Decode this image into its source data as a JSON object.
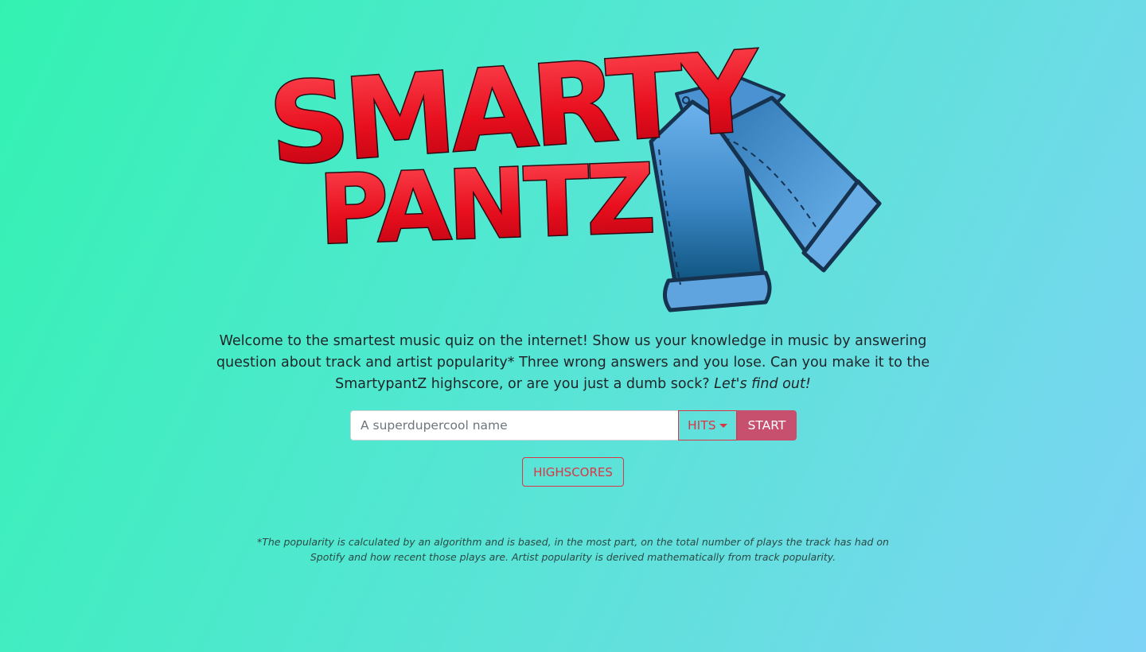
{
  "logo": {
    "line1": "SMARTY",
    "line2": "PANTZ",
    "icon": "jeans-icon",
    "colors": {
      "letters": "#e8101e",
      "outline": "#16324f",
      "jeans_light": "#5aa6e6",
      "jeans_dark": "#0d5a86"
    }
  },
  "intro": {
    "text": "Welcome to the smartest music quiz on the internet! Show us your knowledge in music by answering question about track and artist popularity* Three wrong answers and you lose. Can you make it to the SmartypantZ highscore, or are you just a dumb sock?",
    "emphasis": "Let's find out!"
  },
  "form": {
    "name_placeholder": "A superdupercool name",
    "name_value": "",
    "mode_label": "HITS",
    "start_label": "START"
  },
  "highscores_label": "HIGHSCORES",
  "footnote": "*The popularity is calculated by an algorithm and is based, in the most part, on the total number of plays the track has had on Spotify and how recent those plays are. Artist popularity is derived mathematically from track popularity.",
  "colors": {
    "accent": "#dc3545",
    "start_bg": "#c7506e",
    "bg_start": "#33f2b1",
    "bg_end": "#7dd3f6"
  }
}
